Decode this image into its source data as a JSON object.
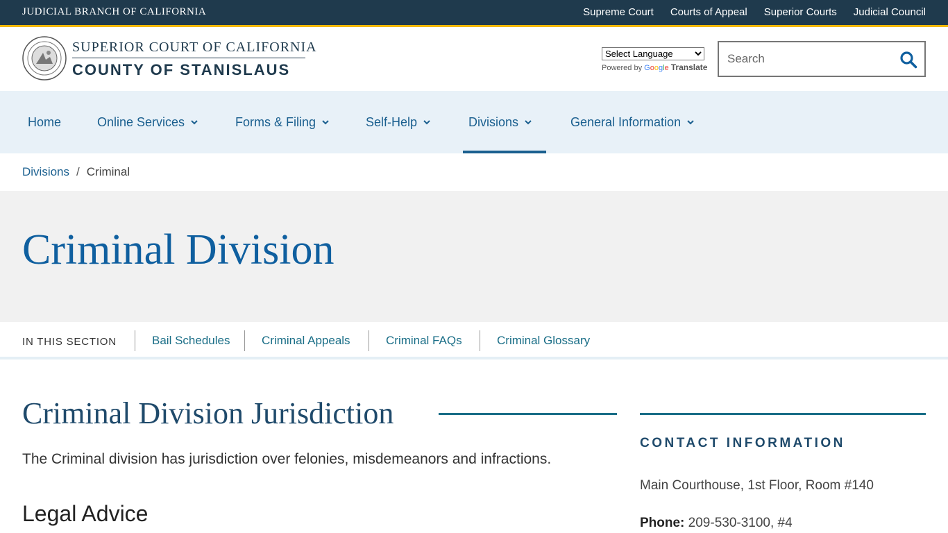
{
  "topbar": {
    "branch": "JUDICIAL BRANCH OF CALIFORNIA",
    "links": [
      "Supreme Court",
      "Courts of Appeal",
      "Superior Courts",
      "Judicial Council"
    ]
  },
  "header": {
    "court_line1": "SUPERIOR COURT OF CALIFORNIA",
    "court_line2": "COUNTY OF STANISLAUS",
    "seal_icon": "court-seal-icon",
    "language": {
      "selected": "Select Language",
      "powered_by": "Powered by",
      "google": "Google",
      "translate": "Translate"
    },
    "search": {
      "placeholder": "Search",
      "icon": "search-icon"
    }
  },
  "nav": {
    "items": [
      {
        "label": "Home",
        "dropdown": false
      },
      {
        "label": "Online Services",
        "dropdown": true
      },
      {
        "label": "Forms & Filing",
        "dropdown": true
      },
      {
        "label": "Self-Help",
        "dropdown": true
      },
      {
        "label": "Divisions",
        "dropdown": true,
        "active": true
      },
      {
        "label": "General Information",
        "dropdown": true
      }
    ]
  },
  "breadcrumb": {
    "parent": "Divisions",
    "separator": "/",
    "current": "Criminal"
  },
  "hero": {
    "title": "Criminal Division"
  },
  "section_nav": {
    "label": "IN THIS SECTION",
    "links": [
      "Bail Schedules",
      "Criminal Appeals",
      "Criminal FAQs",
      "Criminal Glossary"
    ]
  },
  "main": {
    "heading": "Criminal Division Jurisdiction",
    "paragraph": "The Criminal division has jurisdiction over felonies, misdemeanors and infractions.",
    "subheading": "Legal Advice"
  },
  "sidebar": {
    "title": "CONTACT INFORMATION",
    "address": "Main Courthouse, 1st Floor, Room #140",
    "phone_label": "Phone:",
    "phone_value": "209-530-3100, #4"
  },
  "colors": {
    "topbar": "#1f3a4d",
    "accent": "#f2b705",
    "link": "#1a5f8f",
    "nav_bg": "#e8f1f8",
    "hero_bg": "#f1f1f1",
    "title": "#0f5f9f"
  }
}
